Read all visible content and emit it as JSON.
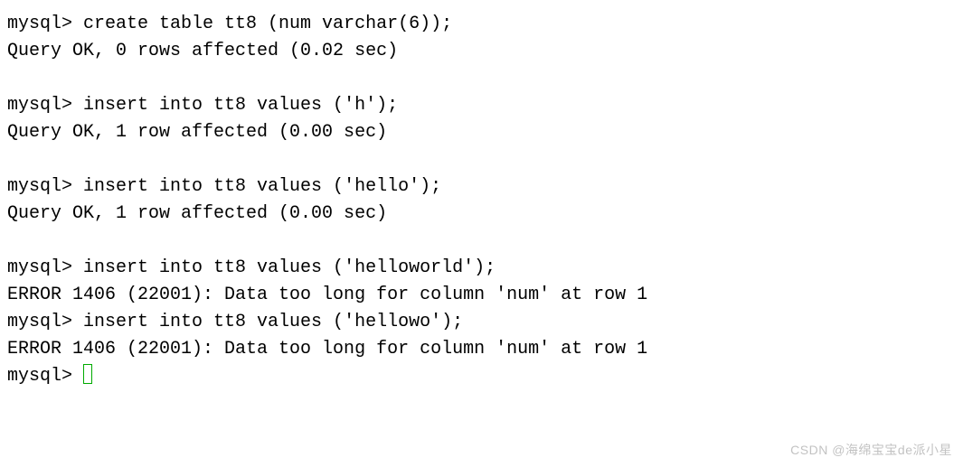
{
  "terminal": {
    "prompt": "mysql> ",
    "lines": [
      {
        "type": "cmd",
        "text": "create table tt8 (num varchar(6));"
      },
      {
        "type": "out",
        "text": "Query OK, 0 rows affected (0.02 sec)"
      },
      {
        "type": "blank",
        "text": ""
      },
      {
        "type": "cmd",
        "text": "insert into tt8 values ('h');"
      },
      {
        "type": "out",
        "text": "Query OK, 1 row affected (0.00 sec)"
      },
      {
        "type": "blank",
        "text": ""
      },
      {
        "type": "cmd",
        "text": "insert into tt8 values ('hello');"
      },
      {
        "type": "out",
        "text": "Query OK, 1 row affected (0.00 sec)"
      },
      {
        "type": "blank",
        "text": ""
      },
      {
        "type": "cmd",
        "text": "insert into tt8 values ('helloworld');"
      },
      {
        "type": "out",
        "text": "ERROR 1406 (22001): Data too long for column 'num' at row 1"
      },
      {
        "type": "cmd",
        "text": "insert into tt8 values ('hellowo');"
      },
      {
        "type": "out",
        "text": "ERROR 1406 (22001): Data too long for column 'num' at row 1"
      },
      {
        "type": "cursor",
        "text": ""
      }
    ]
  },
  "watermark": "CSDN @海绵宝宝de派小星"
}
